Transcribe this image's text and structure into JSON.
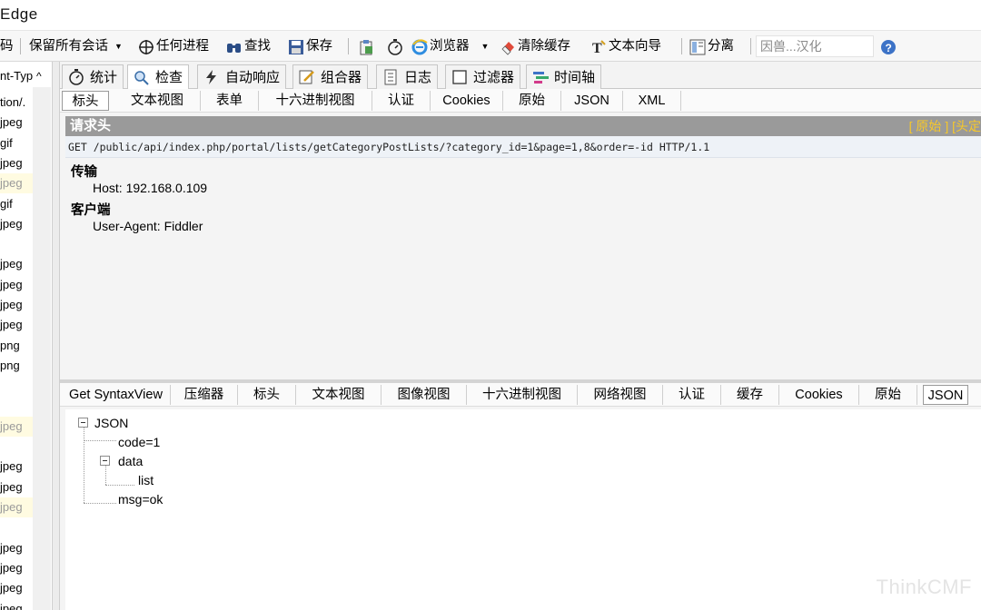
{
  "window": {
    "title": "Edge"
  },
  "toolbar": {
    "items": [
      {
        "label": "码",
        "icon": "none"
      },
      {
        "label": "保留所有会话",
        "icon": "dropdown-arrow-icon"
      },
      {
        "label": "任何进程",
        "icon": "crosshair-icon"
      },
      {
        "label": "查找",
        "icon": "binoculars-icon"
      },
      {
        "label": "保存",
        "icon": "save-icon"
      },
      {
        "label": "",
        "icon": "clipboard-icon"
      },
      {
        "label": "",
        "icon": "timer-icon"
      },
      {
        "label": "浏览器",
        "icon": "ie-browser-icon"
      },
      {
        "label": "清除缓存",
        "icon": "eraser-icon"
      },
      {
        "label": "文本向导",
        "icon": "text-wizard-icon"
      },
      {
        "label": "分离",
        "icon": "detach-icon"
      }
    ],
    "search_placeholder": "因兽...汉化",
    "help_icon": "help-icon"
  },
  "session_list": {
    "header": "nt-Typ",
    "rows": [
      {
        "text": "tion/.",
        "highlight": false
      },
      {
        "text": "jpeg",
        "highlight": false
      },
      {
        "text": "gif",
        "highlight": false
      },
      {
        "text": "jpeg",
        "highlight": false
      },
      {
        "text": "jpeg",
        "highlight": true
      },
      {
        "text": "gif",
        "highlight": false
      },
      {
        "text": "jpeg",
        "highlight": false
      },
      {
        "text": "",
        "highlight": false
      },
      {
        "text": "jpeg",
        "highlight": false
      },
      {
        "text": "jpeg",
        "highlight": false
      },
      {
        "text": "jpeg",
        "highlight": false
      },
      {
        "text": "jpeg",
        "highlight": false
      },
      {
        "text": "png",
        "highlight": false
      },
      {
        "text": "png",
        "highlight": false
      },
      {
        "text": "",
        "highlight": false
      },
      {
        "text": "",
        "highlight": false
      },
      {
        "text": "jpeg",
        "highlight": true
      },
      {
        "text": "",
        "highlight": false
      },
      {
        "text": "jpeg",
        "highlight": false
      },
      {
        "text": "jpeg",
        "highlight": false
      },
      {
        "text": "jpeg",
        "highlight": true
      },
      {
        "text": "",
        "highlight": false
      },
      {
        "text": "jpeg",
        "highlight": false
      },
      {
        "text": "jpeg",
        "highlight": false
      },
      {
        "text": "jpeg",
        "highlight": false
      },
      {
        "text": "jpeg",
        "highlight": false
      }
    ]
  },
  "main_tabs": [
    {
      "label": "统计",
      "icon": "stopwatch-icon"
    },
    {
      "label": "检查",
      "icon": "inspect-icon",
      "active": true
    },
    {
      "label": "自动响应",
      "icon": "lightning-icon"
    },
    {
      "label": "组合器",
      "icon": "composer-icon"
    },
    {
      "label": "日志",
      "icon": "log-icon"
    },
    {
      "label": "过滤器",
      "icon": "checkbox-icon"
    },
    {
      "label": "时间轴",
      "icon": "timeline-icon"
    }
  ],
  "request_tabs": [
    "标头",
    "文本视图",
    "表单",
    "十六进制视图",
    "认证",
    "Cookies",
    "原始",
    "JSON",
    "XML"
  ],
  "request": {
    "section_title": "请求头",
    "links": "[ 原始 ]  [头定",
    "request_line": "GET /public/api/index.php/portal/lists/getCategoryPostLists/?category_id=1&page=1,8&order=-id HTTP/1.1",
    "groups": [
      {
        "name": "传输",
        "headers": [
          "Host: 192.168.0.109"
        ]
      },
      {
        "name": "客户端",
        "headers": [
          "User-Agent: Fiddler"
        ]
      }
    ]
  },
  "response_tabs": [
    "Get SyntaxView",
    "压缩器",
    "标头",
    "文本视图",
    "图像视图",
    "十六进制视图",
    "网络视图",
    "认证",
    "缓存",
    "Cookies",
    "原始",
    "JSON"
  ],
  "json_tree": {
    "root": "JSON",
    "code": "code=1",
    "data": "data",
    "list": "list",
    "msg": "msg=ok"
  },
  "watermark": "ThinkCMF"
}
